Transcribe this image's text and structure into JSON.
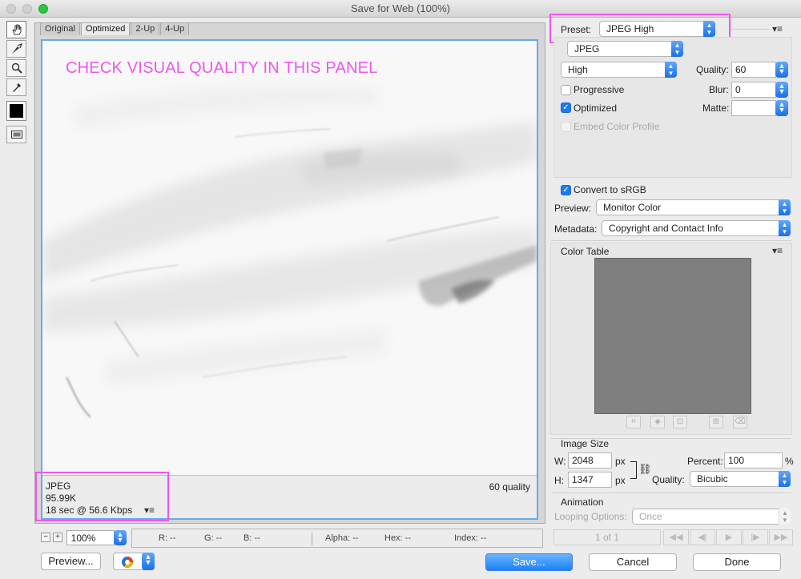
{
  "window": {
    "title": "Save for Web (100%)"
  },
  "tabs": [
    "Original",
    "Optimized",
    "2-Up",
    "4-Up"
  ],
  "toolbox": {
    "tools": [
      "hand-tool",
      "slice-select-tool",
      "zoom-tool",
      "eyedropper-tool"
    ],
    "eyedropper_color": "#000000"
  },
  "canvas": {
    "annotation": "CHECK VISUAL QUALITY IN THIS PANEL",
    "annotation_color": "#ef56ee",
    "info": {
      "format": "JPEG",
      "size": "95.99K",
      "download_time": "18 sec @ 56.6 Kbps",
      "quality": "60 quality"
    }
  },
  "zoom": {
    "minus": "−",
    "plus": "+",
    "value": "100%"
  },
  "readouts": {
    "r": "R: --",
    "g": "G: --",
    "b": "B: --",
    "alpha": "Alpha: --",
    "hex": "Hex: --",
    "index": "Index: --"
  },
  "buttons": {
    "preview": "Preview...",
    "save": "Save...",
    "cancel": "Cancel",
    "done": "Done"
  },
  "settings": {
    "preset_label": "Preset:",
    "preset_value": "JPEG High",
    "format_value": "JPEG",
    "compression_value": "High",
    "quality_label": "Quality:",
    "quality_value": "60",
    "blur_label": "Blur:",
    "blur_value": "0",
    "matte_label": "Matte:",
    "matte_value": "",
    "progressive_label": "Progressive",
    "progressive_checked": false,
    "optimized_label": "Optimized",
    "optimized_checked": true,
    "embed_label": "Embed Color Profile",
    "embed_checked": false,
    "convert_label": "Convert to sRGB",
    "convert_checked": true,
    "preview_label": "Preview:",
    "preview_value": "Monitor Color",
    "metadata_label": "Metadata:",
    "metadata_value": "Copyright and Contact Info"
  },
  "color_table": {
    "title": "Color Table",
    "fill_color": "#7f7f7f"
  },
  "image_size": {
    "title": "Image Size",
    "w_label": "W:",
    "w_value": "2048",
    "h_label": "H:",
    "h_value": "1347",
    "unit": "px",
    "percent_label": "Percent:",
    "percent_value": "100",
    "percent_unit": "%",
    "quality_label": "Quality:",
    "quality_value": "Bicubic"
  },
  "animation": {
    "title": "Animation",
    "looping_label": "Looping Options:",
    "looping_value": "Once",
    "frame_counter": "1 of 1"
  },
  "highlight_color": "#ef56ee",
  "accent_color": "#1d7bf5"
}
